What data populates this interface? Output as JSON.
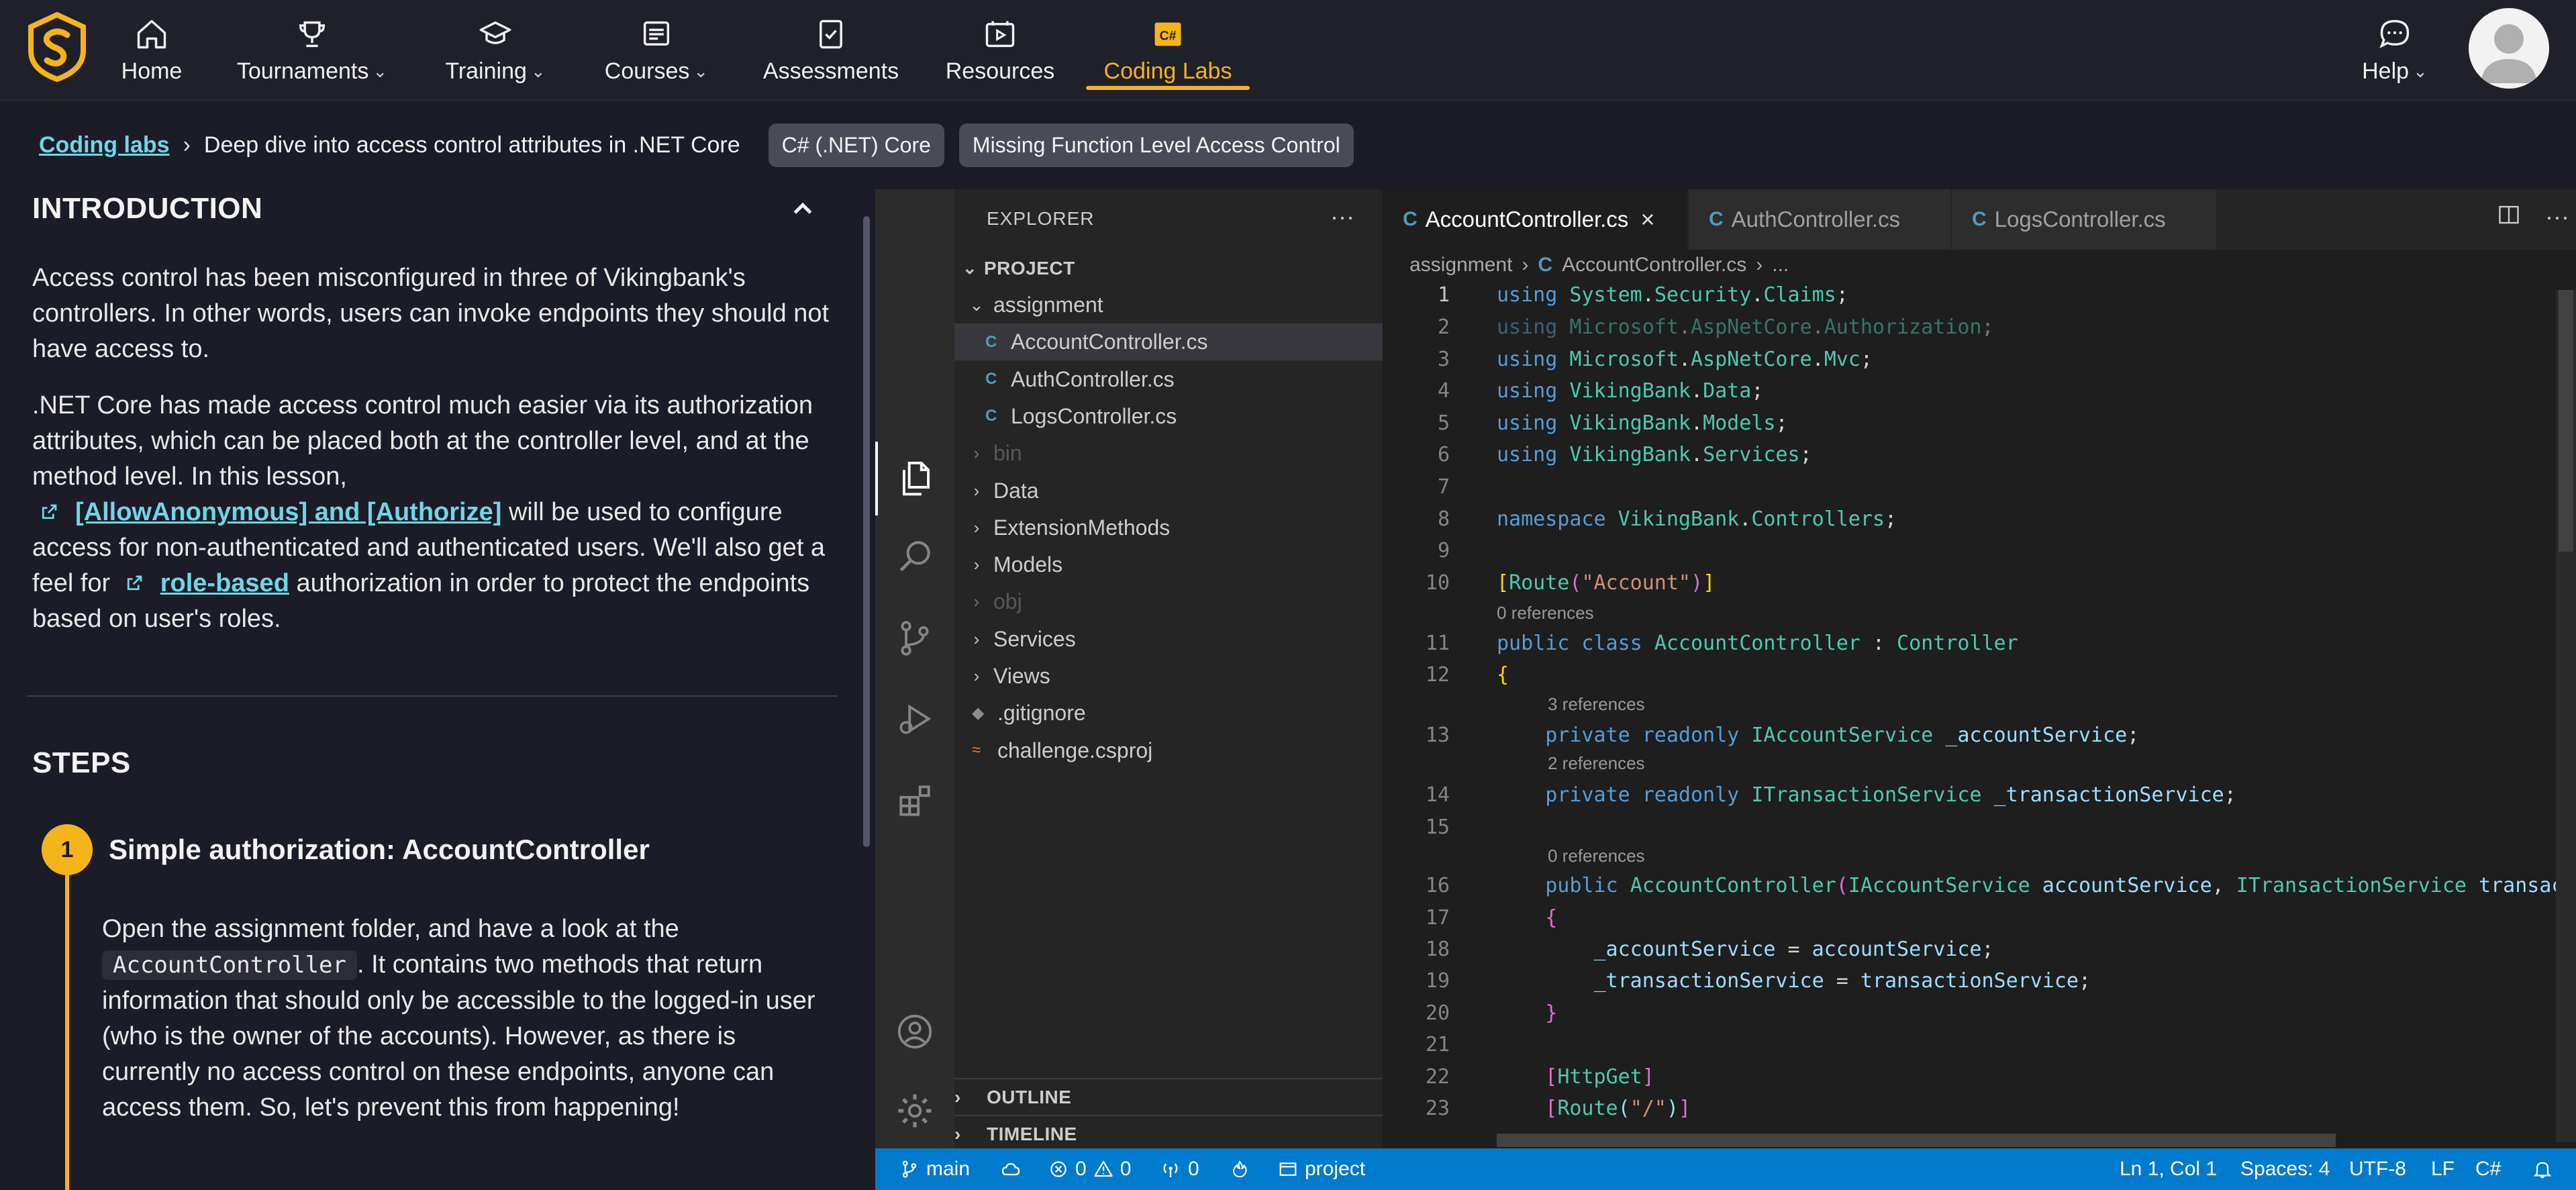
{
  "nav": {
    "items": [
      {
        "label": "Home",
        "icon": "home-icon",
        "dropdown": false
      },
      {
        "label": "Tournaments",
        "icon": "trophy-icon",
        "dropdown": true
      },
      {
        "label": "Training",
        "icon": "graduation-cap-icon",
        "dropdown": true
      },
      {
        "label": "Courses",
        "icon": "courses-icon",
        "dropdown": true
      },
      {
        "label": "Assessments",
        "icon": "assessment-icon",
        "dropdown": false
      },
      {
        "label": "Resources",
        "icon": "video-icon",
        "dropdown": false
      },
      {
        "label": "Coding Labs",
        "icon": "csharp-lab-icon",
        "dropdown": false,
        "active": true
      }
    ],
    "help_label": "Help",
    "accent": "#f4b41a"
  },
  "breadcrumb": {
    "root": "Coding labs",
    "current": "Deep dive into access control attributes in .NET Core",
    "tags": [
      "C# (.NET) Core",
      "Missing Function Level Access Control"
    ]
  },
  "lesson": {
    "intro_title": "INTRODUCTION",
    "intro_p1": "Access control has been misconfigured in three of Vikingbank's controllers. In other words, users can invoke endpoints they should not have access to.",
    "intro_p2_a": ".NET Core has made access control much easier via its authorization attributes, which can be placed both at the controller level, and at the method level. In this lesson,",
    "intro_link1": "[AllowAnonymous] and [Authorize]",
    "intro_p2_b": "will be used to configure access for non-authenticated and authenticated users. We'll also get a feel for",
    "intro_link2": "role-based",
    "intro_p2_c": "authorization in order to protect the endpoints based on user's roles.",
    "steps_title": "STEPS",
    "step1": {
      "number": "1",
      "title": "Simple authorization: AccountController",
      "text_a": "Open the assignment folder, and have a look at the",
      "code": "AccountController",
      "text_b": ". It contains two methods that return information that should only be accessible to the logged-in user (who is the owner of the accounts). However, as there is currently no access control on these endpoints, anyone can access them. So, let's prevent this from happening!"
    }
  },
  "explorer": {
    "title": "EXPLORER",
    "more": "···",
    "project": "PROJECT",
    "tree": [
      {
        "label": "assignment",
        "type": "folder-open",
        "depth": 1
      },
      {
        "label": "AccountController.cs",
        "type": "cs",
        "depth": 2,
        "selected": true
      },
      {
        "label": "AuthController.cs",
        "type": "cs",
        "depth": 2
      },
      {
        "label": "LogsController.cs",
        "type": "cs",
        "depth": 2
      },
      {
        "label": "bin",
        "type": "folder",
        "depth": 1,
        "dim": true
      },
      {
        "label": "Data",
        "type": "folder",
        "depth": 1
      },
      {
        "label": "ExtensionMethods",
        "type": "folder",
        "depth": 1
      },
      {
        "label": "Models",
        "type": "folder",
        "depth": 1
      },
      {
        "label": "obj",
        "type": "folder",
        "depth": 1,
        "dim": true
      },
      {
        "label": "Services",
        "type": "folder",
        "depth": 1
      },
      {
        "label": "Views",
        "type": "folder",
        "depth": 1
      },
      {
        "label": ".gitignore",
        "type": "git",
        "depth": 1
      },
      {
        "label": "challenge.csproj",
        "type": "rss",
        "depth": 1
      }
    ],
    "outline": "OUTLINE",
    "timeline": "TIMELINE"
  },
  "editor": {
    "tabs": [
      {
        "label": "AccountController.cs",
        "active": true
      },
      {
        "label": "AuthController.cs",
        "active": false
      },
      {
        "label": "LogsController.cs",
        "active": false
      }
    ],
    "crumbs": [
      "assignment",
      "AccountController.cs",
      "..."
    ],
    "references": {
      "r10": "0 references",
      "r12": "3 references",
      "r13": "2 references",
      "r15": "0 references"
    }
  },
  "status": {
    "branch": "main",
    "errors": "0",
    "warnings": "0",
    "ports": "0",
    "folder": "project",
    "position": "Ln 1, Col 1",
    "spaces": "Spaces: 4",
    "encoding": "UTF-8",
    "eol": "LF",
    "language": "C#"
  }
}
